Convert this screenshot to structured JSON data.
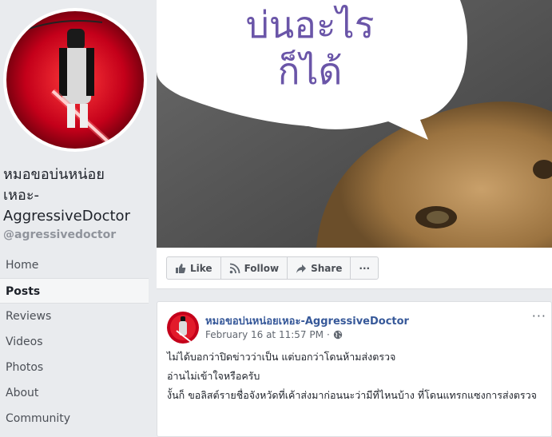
{
  "page": {
    "name": "หมอขอบ่นหน่อยเหอะ-AggressiveDoctor",
    "name_lines": [
      "หมอขอบ่นหน่อย",
      "เหอะ-",
      "AggressiveDoctor"
    ],
    "handle": "@agressivedoctor"
  },
  "sidebar": {
    "items": [
      {
        "label": "Home",
        "active": false
      },
      {
        "label": "Posts",
        "active": true
      },
      {
        "label": "Reviews",
        "active": false
      },
      {
        "label": "Videos",
        "active": false
      },
      {
        "label": "Photos",
        "active": false
      },
      {
        "label": "About",
        "active": false
      },
      {
        "label": "Community",
        "active": false
      }
    ]
  },
  "cover": {
    "line1": "บ่นอะไร",
    "line2": "ก็ได้"
  },
  "actions": {
    "like": "Like",
    "follow": "Follow",
    "share": "Share",
    "more": "···"
  },
  "post": {
    "author": "หมอขอบ่นหน่อยเหอะ-AggressiveDoctor",
    "timestamp": "February 16 at 11:57 PM",
    "separator": "·",
    "paragraphs": [
      "ไม่ได้บอกว่าปิดข่าวว่าเป็น แต่บอกว่าโดนห้ามส่งตรวจ",
      "อ่านไม่เข้าใจหรือครับ",
      "งั้นก็ ขอลิสต์รายชื่อจังหวัดที่เค้าส่งมาก่อนนะว่ามีที่ไหนบ้าง ที่โดนแทรกแซงการส่งตรวจ"
    ],
    "more": "···"
  }
}
